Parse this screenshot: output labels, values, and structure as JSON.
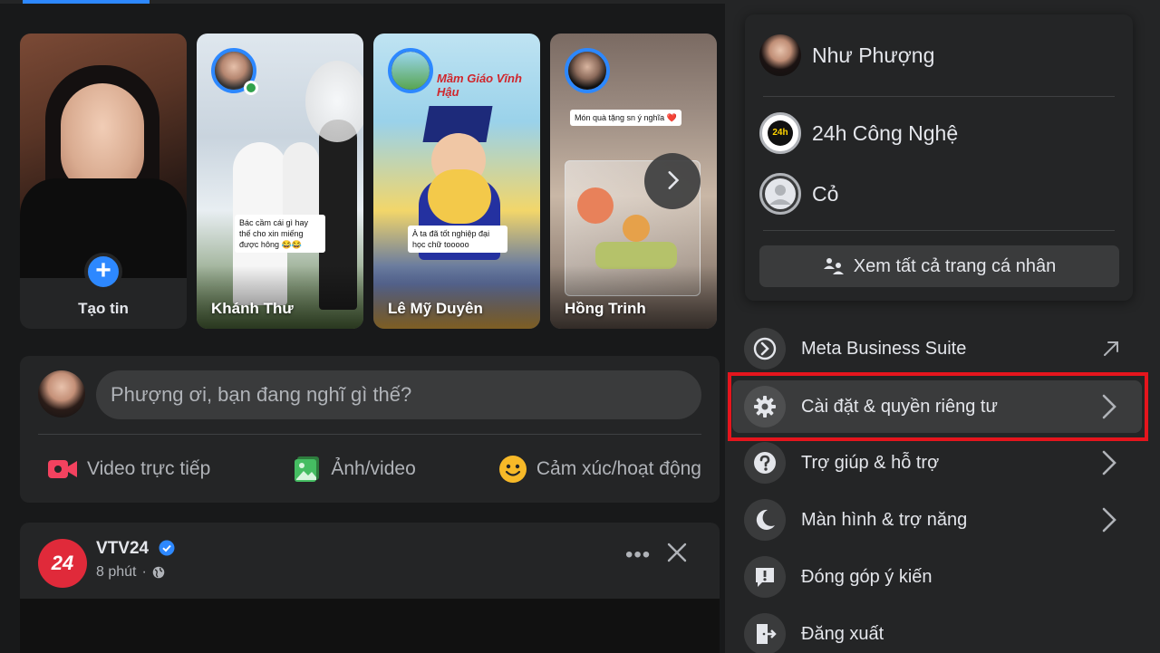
{
  "stories": {
    "create_label": "Tạo tin",
    "items": [
      {
        "name": "Khánh Thư",
        "caption": "Bác cầm cái gì hay thế cho xin miếng được hông 😂😂"
      },
      {
        "name": "Lê Mỹ Duyên",
        "caption": "À ta đã tốt nghiệp đại học chữ tooooo",
        "banner": "Mầm Giáo Vĩnh Hậu"
      },
      {
        "name": "Hồng Trinh",
        "caption": "Món quà tặng sn ý nghĩa ❤️"
      }
    ]
  },
  "composer": {
    "placeholder": "Phượng ơi, bạn đang nghĩ gì thế?",
    "actions": {
      "live": "Video trực tiếp",
      "photo": "Ảnh/video",
      "feeling": "Cảm xúc/hoạt động"
    }
  },
  "post": {
    "page_name": "VTV24",
    "logo_text": "24",
    "time": "8 phút",
    "more": "•••"
  },
  "menu": {
    "profiles": [
      {
        "name": "Như Phượng"
      },
      {
        "name": "24h Công Nghệ",
        "avatar_text": "24h"
      },
      {
        "name": "Cỏ"
      }
    ],
    "see_all": "Xem tất cả trang cá nhân",
    "items": [
      {
        "label": "Meta Business Suite",
        "icon": "meta-business-icon"
      },
      {
        "label": "Cài đặt & quyền riêng tư",
        "icon": "gear-icon"
      },
      {
        "label": "Trợ giúp & hỗ trợ",
        "icon": "help-icon"
      },
      {
        "label": "Màn hình & trợ năng",
        "icon": "moon-icon"
      },
      {
        "label": "Đóng góp ý kiến",
        "icon": "feedback-icon"
      },
      {
        "label": "Đăng xuất",
        "icon": "logout-icon"
      }
    ]
  },
  "colors": {
    "accent": "#2d88ff",
    "highlight": "#e5151d",
    "online": "#31a24c",
    "live_red": "#f3425f",
    "photo_green": "#45bd62",
    "feeling_yellow": "#f7b928"
  }
}
